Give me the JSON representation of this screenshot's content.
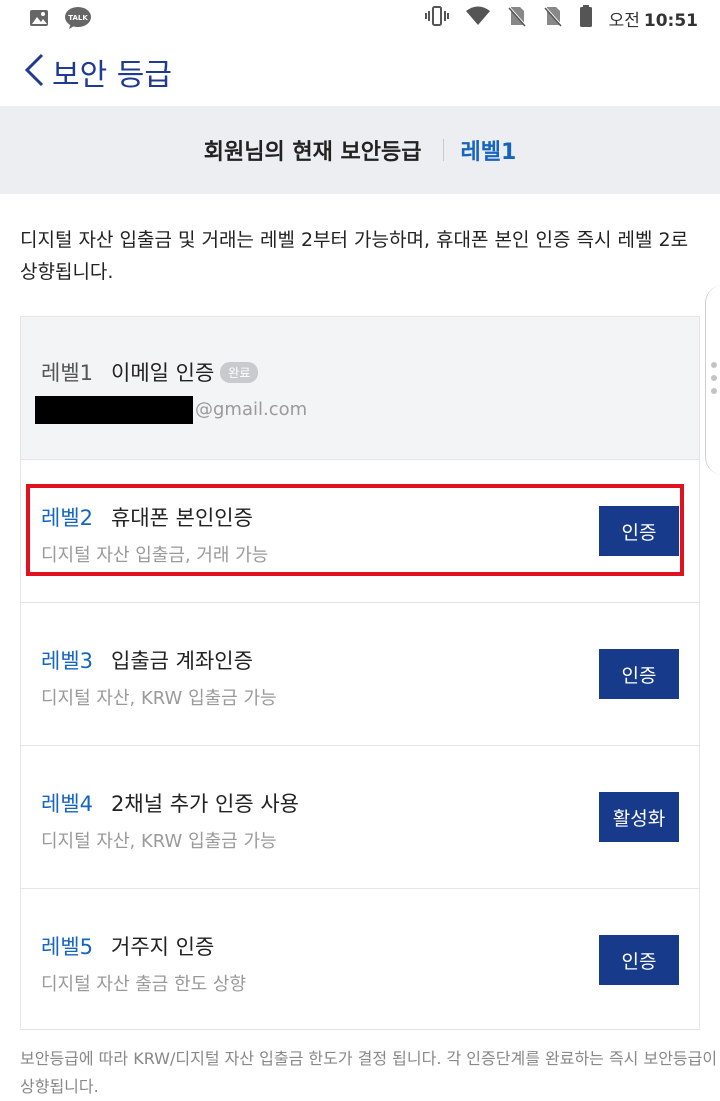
{
  "status_bar": {
    "icons_left": [
      "gallery-icon",
      "kakaotalk-icon"
    ],
    "kakao_label": "TALK",
    "icons_right": [
      "vibrate-icon",
      "wifi-icon",
      "no-sim-icon",
      "no-sim-icon",
      "battery-icon"
    ],
    "ampm": "오전",
    "time": "10:51"
  },
  "header": {
    "title": "보안 등급"
  },
  "banner": {
    "text": "회원님의 현재 보안등급",
    "level": "레벨1"
  },
  "description": "디지털 자산 입출금 및 거래는 레벨 2부터 가능하며, 휴대폰 본인 인증 즉시 레벨 2로 상향됩니다.",
  "levels": [
    {
      "level": "레벨1",
      "title": "이메일 인증",
      "badge": "완료",
      "email_suffix": "@gmail.com"
    },
    {
      "level": "레벨2",
      "title": "휴대폰 본인인증",
      "subtitle": "디지털 자산 입출금, 거래 가능",
      "button": "인증"
    },
    {
      "level": "레벨3",
      "title": "입출금 계좌인증",
      "subtitle": "디지털 자산, KRW 입출금 가능",
      "button": "인증"
    },
    {
      "level": "레벨4",
      "title": "2채널 추가 인증 사용",
      "subtitle": "디지털 자산, KRW 입출금 가능",
      "button": "활성화"
    },
    {
      "level": "레벨5",
      "title": "거주지 인증",
      "subtitle": "디지털 자산 출금 한도 상향",
      "button": "인증"
    }
  ],
  "footnote": "보안등급에 따라 KRW/디지털 자산 입출금 한도가 결정 됩니다. 각 인증단계를 완료하는 즉시 보안등급이 상향됩니다.",
  "colors": {
    "accent_blue": "#1565c0",
    "button_navy": "#173a8a",
    "highlight_red": "#e0121f"
  }
}
